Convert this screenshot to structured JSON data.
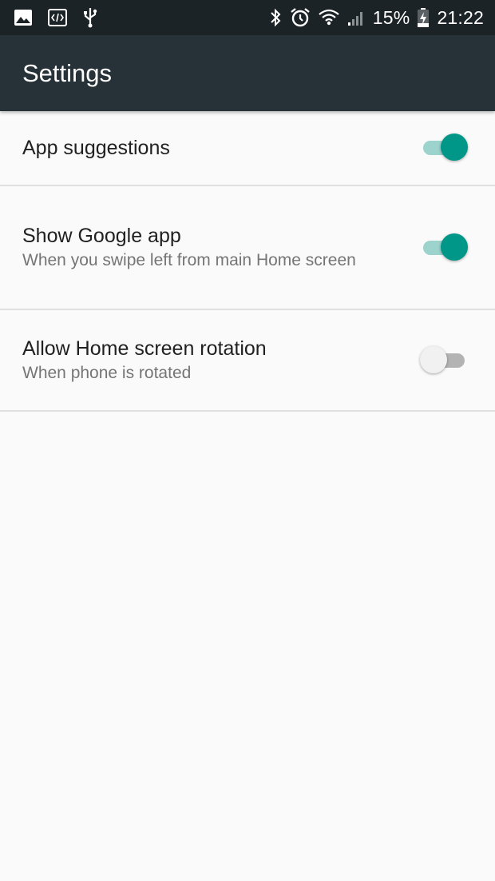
{
  "status_bar": {
    "left_icons": [
      "image-icon",
      "code-icon",
      "usb-icon"
    ],
    "right_icons": [
      "bluetooth-icon",
      "alarm-icon",
      "wifi-icon",
      "signal-icon",
      "battery-charging-icon"
    ],
    "battery": "15%",
    "time": "21:22"
  },
  "app_bar": {
    "title": "Settings"
  },
  "settings": [
    {
      "title": "App suggestions",
      "summary": "",
      "enabled": true
    },
    {
      "title": "Show Google app",
      "summary": "When you swipe left from main Home screen",
      "enabled": true
    },
    {
      "title": "Allow Home screen rotation",
      "summary": "When phone is rotated",
      "enabled": false
    }
  ],
  "colors": {
    "app_bar": "#263238",
    "status_bar": "#1c2326",
    "accent": "#009688",
    "accent_track": "#9dd3cd",
    "background": "#fafafa"
  }
}
